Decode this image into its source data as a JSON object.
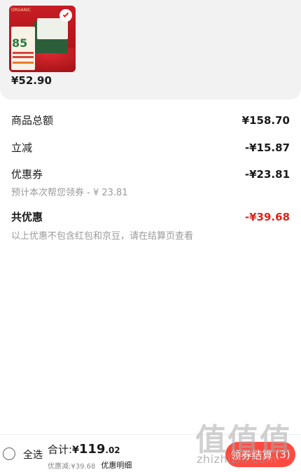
{
  "product": {
    "thumb_brand": "ORGANIC",
    "thumb_promo": "85",
    "price": "¥52.90"
  },
  "summary": {
    "goods_total_label": "商品总额",
    "goods_total_value": "¥158.70",
    "instant_discount_label": "立减",
    "instant_discount_value": "-¥15.87",
    "coupon_label": "优惠券",
    "coupon_value": "-¥23.81",
    "coupon_note": "预计本次帮您领券 - ¥ 23.81",
    "total_discount_label": "共优惠",
    "total_discount_value": "-¥39.68",
    "footnote": "以上优惠不包含红包和京豆，请在结算页查看"
  },
  "bottom_bar": {
    "select_all_label": "全选",
    "total_label": "合计:",
    "total_currency": "¥",
    "total_integer": "119",
    "total_decimal": ".02",
    "discount_text": "优惠减:¥39.68",
    "detail_label": "优惠明细",
    "checkout_label": "领券结算",
    "checkout_count": "(3)"
  },
  "watermark": {
    "glyph": "值",
    "site": "zhizhizhi.com"
  },
  "colors": {
    "accent_red": "#e2231a",
    "checkout_bg": "#ff4a40"
  }
}
